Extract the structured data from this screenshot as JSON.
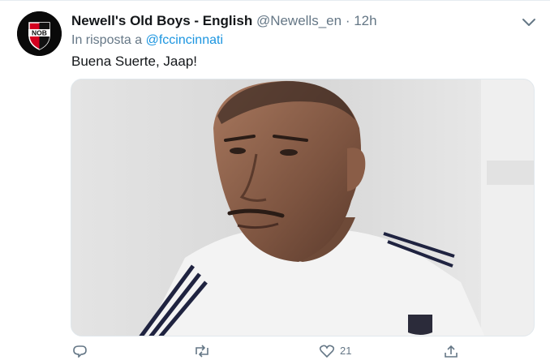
{
  "tweet": {
    "display_name": "Newell's Old Boys - English",
    "handle": "@Newells_en",
    "separator": "·",
    "time": "12h",
    "reply_prefix": "In risposta a",
    "reply_mention": "@fccincinnati",
    "text": "Buena Suerte, Jaap!",
    "like_count": "21"
  },
  "avatar": {
    "logo_text": "NOB"
  },
  "icons": [
    "chevron-down-icon",
    "reply-icon",
    "retweet-icon",
    "like-icon",
    "share-icon"
  ],
  "colors": {
    "link": "#1b95e0",
    "secondary": "#657786",
    "primary_text": "#14171a",
    "brand_red": "#d4001f"
  }
}
